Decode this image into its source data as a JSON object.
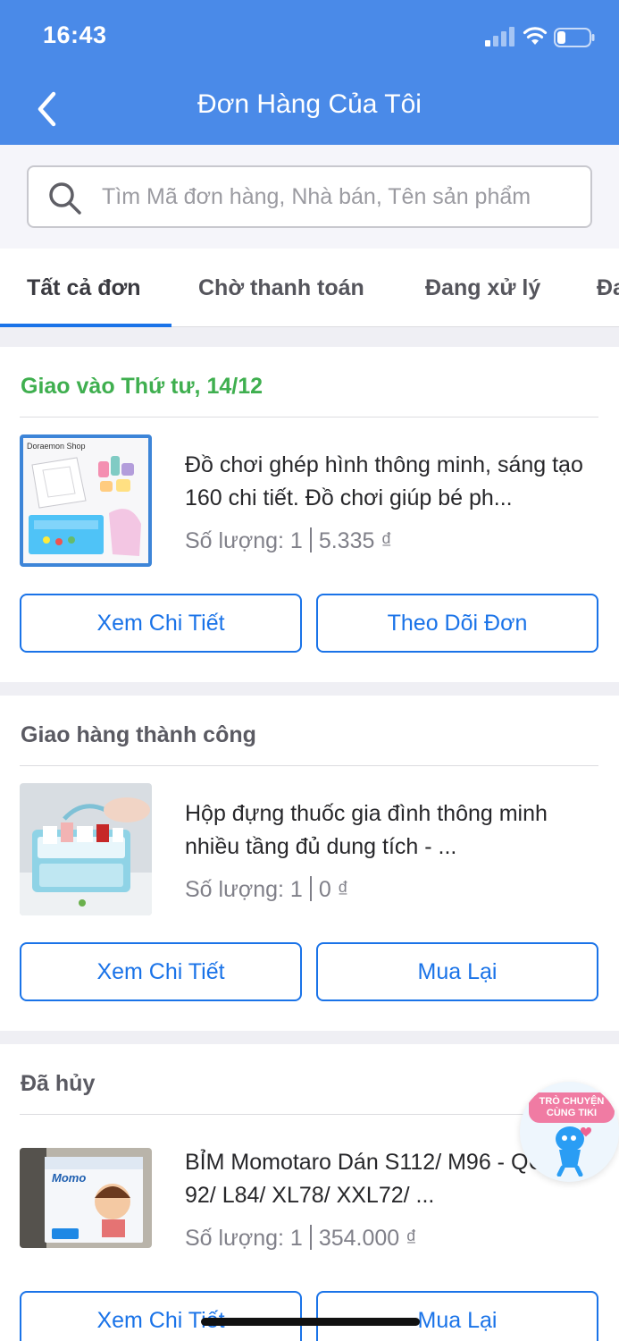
{
  "status_bar": {
    "time": "16:43"
  },
  "header": {
    "title": "Đơn Hàng Của Tôi"
  },
  "search": {
    "placeholder": "Tìm Mã đơn hàng, Nhà bán, Tên sản phẩm"
  },
  "tabs": [
    {
      "label": "Tất cả đơn"
    },
    {
      "label": "Chờ thanh toán"
    },
    {
      "label": "Đang xử lý"
    },
    {
      "label": "Đa"
    }
  ],
  "orders": [
    {
      "status": "Giao vào Thứ tư, 14/12",
      "status_color": "#3faf4f",
      "product_name": "Đồ chơi ghép hình thông minh, sáng tạo 160 chi tiết. Đồ chơi giúp bé ph...",
      "quantity": "Số lượng: 1",
      "price": "5.335 ₫",
      "shop_tag": "Doraemon Shop",
      "buttons": [
        "Xem Chi Tiết",
        "Theo Dõi Đơn"
      ]
    },
    {
      "status": "Giao hàng thành công",
      "status_color": "#5a5a62",
      "product_name": "Hộp đựng thuốc gia đình thông minh nhiều tầng đủ dung tích - ...",
      "quantity": "Số lượng: 1",
      "price": "0 ₫",
      "buttons": [
        "Xem Chi Tiết",
        "Mua Lại"
      ]
    },
    {
      "status": "Đã hủy",
      "status_color": "#5a5a62",
      "product_name": "BỈM Momotaro  Dán S112/ M96 - QUẦN 92/ L84/ XL78/ XXL72/ ...",
      "quantity": "Số lượng: 1",
      "price": "354.000 ₫",
      "buttons": [
        "Xem Chi Tiết",
        "Mua Lại"
      ]
    }
  ],
  "chat": {
    "label": "TRÒ CHUYỆN CÙNG TIKI"
  },
  "colors": {
    "header": "#4a8ae8",
    "primary": "#1a73e8",
    "delivering": "#3faf4f"
  }
}
